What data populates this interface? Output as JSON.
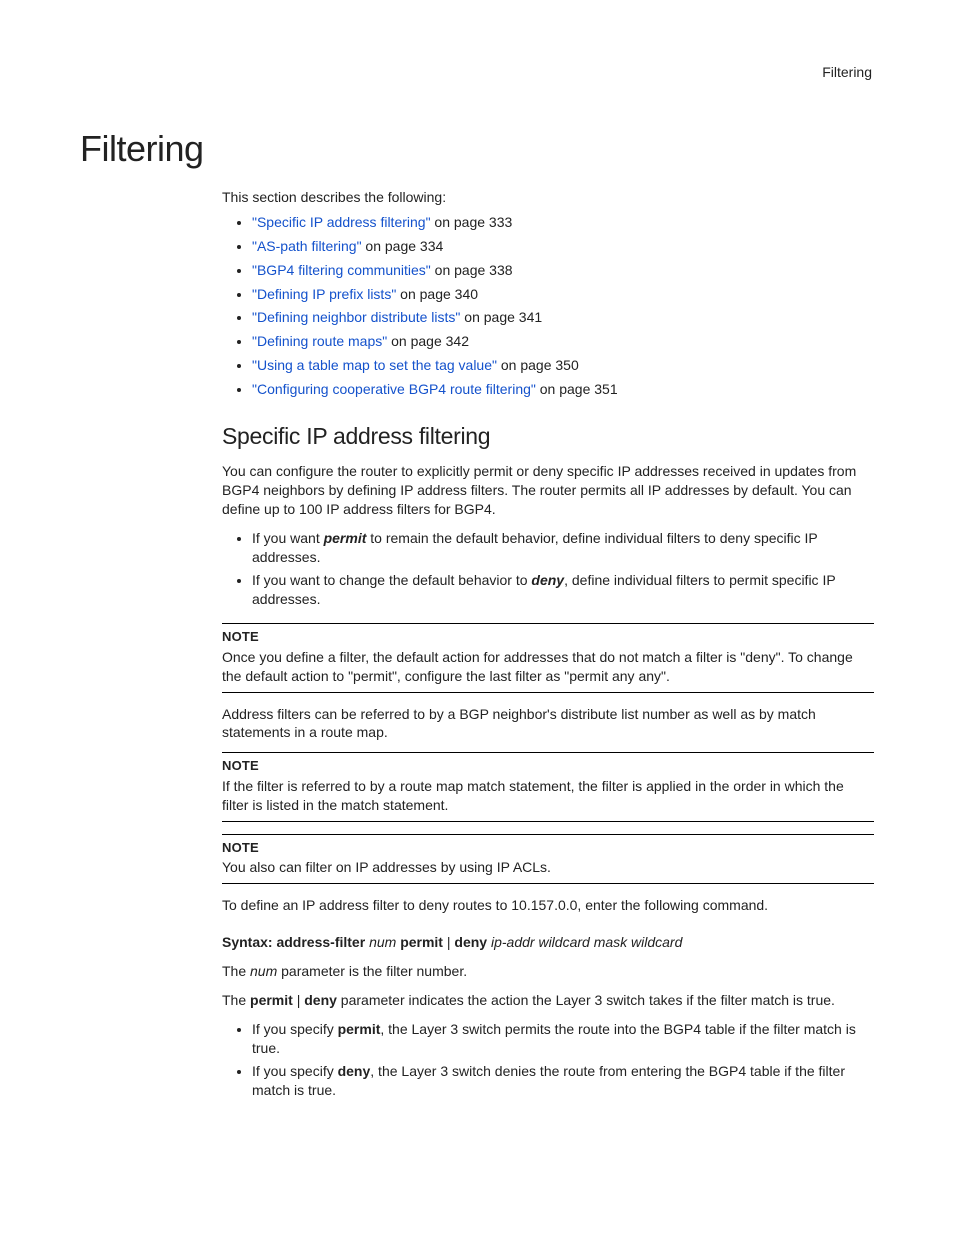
{
  "header": {
    "running_title": "Filtering"
  },
  "title": "Filtering",
  "intro": "This section describes the following:",
  "toc": [
    {
      "link": "\"Specific IP address filtering\"",
      "suffix": " on page 333"
    },
    {
      "link": "\"AS-path filtering\"",
      "suffix": " on page 334"
    },
    {
      "link": "\"BGP4 filtering communities\"",
      "suffix": " on page 338"
    },
    {
      "link": "\"Defining IP prefix lists\"",
      "suffix": " on page 340"
    },
    {
      "link": "\"Defining neighbor distribute lists\"",
      "suffix": " on page 341"
    },
    {
      "link": "\"Defining route maps\"",
      "suffix": " on page 342"
    },
    {
      "link": "\"Using a table map to set the tag value\"",
      "suffix": " on page 350"
    },
    {
      "link": "\"Configuring cooperative BGP4 route filtering\"",
      "suffix": " on page 351"
    }
  ],
  "section_title": "Specific IP address filtering",
  "section_para1": "You can configure the router to explicitly permit or deny specific IP addresses received in updates from BGP4 neighbors by defining IP address filters. The router permits all IP addresses by default. You can define up to 100 IP address filters for BGP4.",
  "section_bullets": [
    {
      "pre": "If you want ",
      "bold": "permit",
      "post": " to remain the default behavior, define individual filters to deny specific IP addresses."
    },
    {
      "pre": "If you want to change the default behavior to ",
      "bold": "deny",
      "post": ", define individual filters to permit specific IP addresses."
    }
  ],
  "notes": [
    {
      "label": "NOTE",
      "body": "Once you define a filter, the default action for addresses that do not match a filter is \"deny\". To change the default action to \"permit\", configure the last filter as \"permit any any\"."
    },
    {
      "label": "NOTE",
      "body": "If the filter is referred to by a route map match statement, the filter is applied in the order in which the filter is listed in the match statement."
    },
    {
      "label": "NOTE",
      "body": "You also can filter on IP addresses by using IP ACLs."
    }
  ],
  "between_notes_para": "Address filters can be referred to by a BGP neighbor's distribute list number as well as by match statements in a route map.",
  "after_notes_para": "To define an IP address filter to deny routes to 10.157.0.0, enter the following command.",
  "syntax": {
    "label": "Syntax:",
    "cmd": "address-filter",
    "num": "num",
    "permit": "permit",
    "pipe": " | ",
    "deny": "deny",
    "args": "ip-addr wildcard mask wildcard"
  },
  "num_para_pre": "The ",
  "num_para_mid": "num",
  "num_para_post": " parameter is the filter number.",
  "permdeny_para": {
    "pre": "The ",
    "permit": "permit",
    "pipe": " | ",
    "deny": "deny",
    "post": " parameter indicates the action the Layer 3 switch takes if the filter match is true."
  },
  "action_bullets": [
    {
      "pre": "If you specify ",
      "bold": "permit",
      "post": ", the Layer 3 switch permits the route into the BGP4 table if the filter match is true."
    },
    {
      "pre": "If you specify ",
      "bold": "deny",
      "post": ", the Layer 3 switch denies the route from entering the BGP4 table if the filter match is true."
    }
  ]
}
